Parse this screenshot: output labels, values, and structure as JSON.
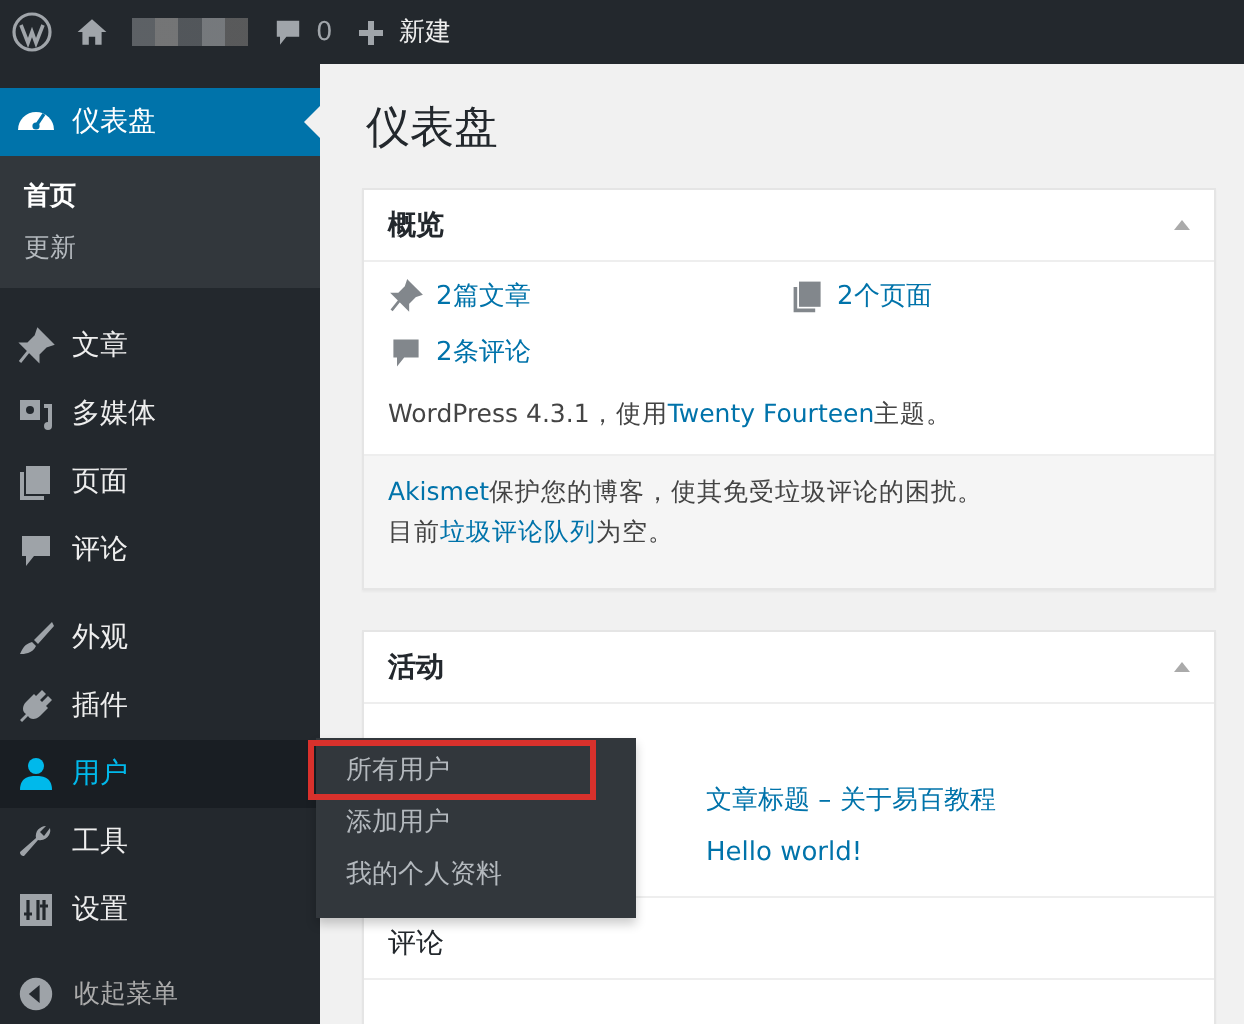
{
  "admin_bar": {
    "comments_count": "0",
    "new_label": "新建"
  },
  "sidebar": {
    "groups": [
      [
        {
          "label": "仪表盘",
          "selected": true,
          "flyout_open": false,
          "children": [
            {
              "label": "首页",
              "selected": true
            },
            {
              "label": "更新",
              "selected": false
            }
          ]
        }
      ],
      [
        {
          "label": "文章",
          "selected": false,
          "flyout_open": false
        },
        {
          "label": "多媒体",
          "selected": false,
          "flyout_open": false
        },
        {
          "label": "页面",
          "selected": false,
          "flyout_open": false
        },
        {
          "label": "评论",
          "selected": false,
          "flyout_open": false
        }
      ],
      [
        {
          "label": "外观",
          "selected": false,
          "flyout_open": false
        },
        {
          "label": "插件",
          "selected": false,
          "flyout_open": false
        },
        {
          "label": "用户",
          "selected": false,
          "flyout_open": true,
          "children": [
            {
              "label": "所有用户",
              "selected": false,
              "highlighted": true
            },
            {
              "label": "添加用户",
              "selected": false,
              "highlighted": false
            },
            {
              "label": "我的个人资料",
              "selected": false,
              "highlighted": false
            }
          ]
        },
        {
          "label": "工具",
          "selected": false,
          "flyout_open": false
        },
        {
          "label": "设置",
          "selected": false,
          "flyout_open": false
        }
      ]
    ],
    "collapse_label": "收起菜单"
  },
  "page_title": "仪表盘",
  "overview": {
    "title": "概览",
    "expanded": true,
    "stats": [
      {
        "text": "2篇文章"
      },
      {
        "text": "2个页面"
      },
      {
        "text": "2条评论"
      }
    ],
    "version": {
      "before": "WordPress 4.3.1，使用",
      "link": "Twenty Fourteen",
      "after": "主题。"
    },
    "akismet": [
      {
        "link": "Akismet",
        "after": "保护您的博客，使其免受垃圾评论的困扰。"
      },
      {
        "before": "目前",
        "link": "垃圾评论队列",
        "after": "为空。"
      }
    ]
  },
  "activity": {
    "title": "活动",
    "expanded": true,
    "recent_posts": [
      "文章标题 – 关于易百教程",
      "Hello world!"
    ],
    "comments_title": "评论"
  }
}
